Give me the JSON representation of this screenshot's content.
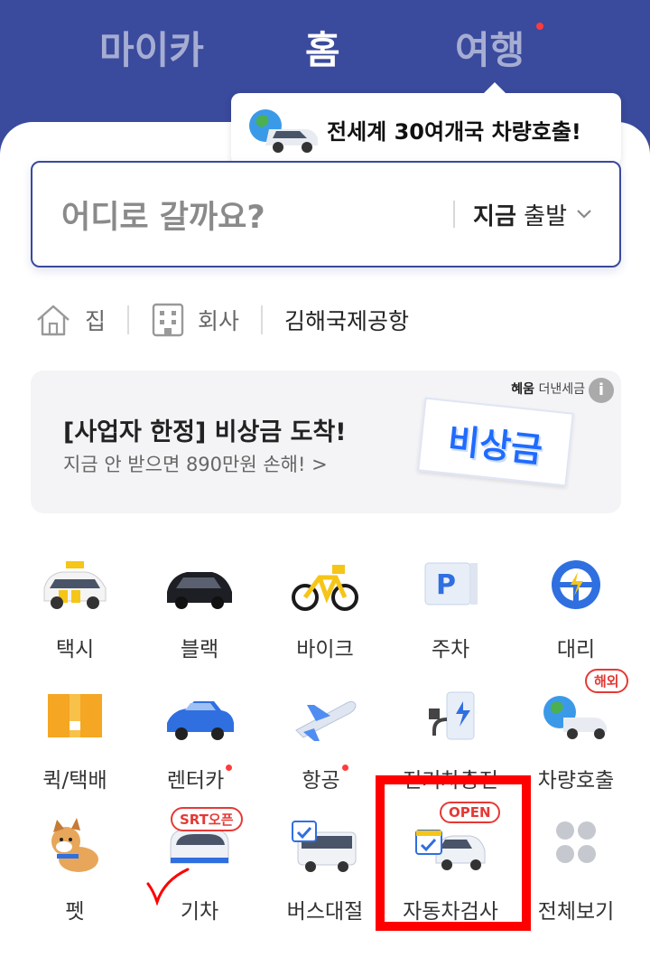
{
  "top_tabs": [
    {
      "label": "마이카",
      "active": false
    },
    {
      "label": "홈",
      "active": true
    },
    {
      "label": "여행",
      "active": false,
      "has_dot": true
    }
  ],
  "tooltip": {
    "text": "전세계 30여개국 차량호출!",
    "icon": "globe-car-icon"
  },
  "search": {
    "placeholder": "어디로 갈까요?",
    "depart_bold": "지금",
    "depart_text": "출발"
  },
  "shortcuts": {
    "home": "집",
    "work": "회사",
    "recent": "김해국제공항"
  },
  "banner": {
    "title": "[사업자 한정] 비상금 도착!",
    "subtitle": "지금 안 받으면 890만원 손해! >",
    "ad_brand": "혜움",
    "ad_text": "더낸세금",
    "sticker": "비상금"
  },
  "services": [
    {
      "label": "택시",
      "icon": "taxi-icon"
    },
    {
      "label": "블랙",
      "icon": "black-car-icon"
    },
    {
      "label": "바이크",
      "icon": "bike-icon"
    },
    {
      "label": "주차",
      "icon": "parking-icon"
    },
    {
      "label": "대리",
      "icon": "steering-wheel-icon"
    },
    {
      "label": "퀵/택배",
      "icon": "box-icon"
    },
    {
      "label": "렌터카",
      "icon": "rental-car-icon",
      "dot": true
    },
    {
      "label": "항공",
      "icon": "airplane-icon",
      "dot": true
    },
    {
      "label": "전기차충전",
      "icon": "ev-charger-icon"
    },
    {
      "label": "차량호출",
      "icon": "globe-car-icon",
      "badge": "해외"
    },
    {
      "label": "펫",
      "icon": "dog-icon"
    },
    {
      "label": "기차",
      "icon": "train-icon",
      "badge": "SRT오픈"
    },
    {
      "label": "버스대절",
      "icon": "bus-icon"
    },
    {
      "label": "자동차검사",
      "icon": "car-inspection-icon",
      "badge": "OPEN"
    },
    {
      "label": "전체보기",
      "icon": "all-view-icon"
    }
  ],
  "colors": {
    "brand_blue": "#3a4a9c",
    "accent_red": "#ff3b3b",
    "highlight": "#ff0000"
  }
}
